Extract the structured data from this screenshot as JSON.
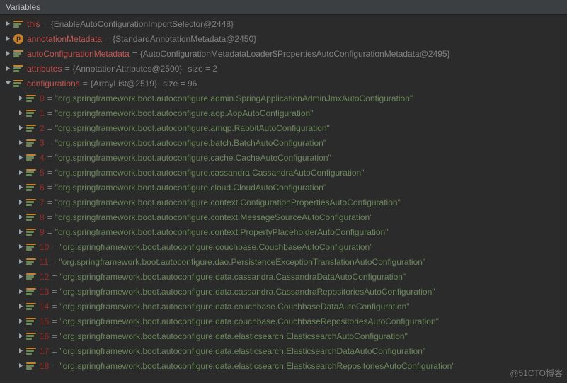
{
  "panelTitle": "Variables",
  "root": [
    {
      "name": "this",
      "value": "{EnableAutoConfigurationImportSelector@2448}",
      "nameColor": "name",
      "iconType": "obj"
    },
    {
      "name": "annotationMetadata",
      "value": "{StandardAnnotationMetadata@2450}",
      "nameColor": "name",
      "iconType": "p"
    },
    {
      "name": "autoConfigurationMetadata",
      "value": "{AutoConfigurationMetadataLoader$PropertiesAutoConfigurationMetadata@2495}",
      "nameColor": "name",
      "iconType": "obj"
    },
    {
      "name": "attributes",
      "value": "{AnnotationAttributes@2500}",
      "size": "size = 2",
      "nameColor": "name",
      "iconType": "obj"
    }
  ],
  "configurations": {
    "name": "configurations",
    "value": "{ArrayList@2519}",
    "size": "size = 96",
    "items": [
      {
        "idx": "0",
        "str": "\"org.springframework.boot.autoconfigure.admin.SpringApplicationAdminJmxAutoConfiguration\""
      },
      {
        "idx": "1",
        "str": "\"org.springframework.boot.autoconfigure.aop.AopAutoConfiguration\""
      },
      {
        "idx": "2",
        "str": "\"org.springframework.boot.autoconfigure.amqp.RabbitAutoConfiguration\""
      },
      {
        "idx": "3",
        "str": "\"org.springframework.boot.autoconfigure.batch.BatchAutoConfiguration\""
      },
      {
        "idx": "4",
        "str": "\"org.springframework.boot.autoconfigure.cache.CacheAutoConfiguration\""
      },
      {
        "idx": "5",
        "str": "\"org.springframework.boot.autoconfigure.cassandra.CassandraAutoConfiguration\""
      },
      {
        "idx": "6",
        "str": "\"org.springframework.boot.autoconfigure.cloud.CloudAutoConfiguration\""
      },
      {
        "idx": "7",
        "str": "\"org.springframework.boot.autoconfigure.context.ConfigurationPropertiesAutoConfiguration\""
      },
      {
        "idx": "8",
        "str": "\"org.springframework.boot.autoconfigure.context.MessageSourceAutoConfiguration\""
      },
      {
        "idx": "9",
        "str": "\"org.springframework.boot.autoconfigure.context.PropertyPlaceholderAutoConfiguration\""
      },
      {
        "idx": "10",
        "str": "\"org.springframework.boot.autoconfigure.couchbase.CouchbaseAutoConfiguration\""
      },
      {
        "idx": "11",
        "str": "\"org.springframework.boot.autoconfigure.dao.PersistenceExceptionTranslationAutoConfiguration\""
      },
      {
        "idx": "12",
        "str": "\"org.springframework.boot.autoconfigure.data.cassandra.CassandraDataAutoConfiguration\""
      },
      {
        "idx": "13",
        "str": "\"org.springframework.boot.autoconfigure.data.cassandra.CassandraRepositoriesAutoConfiguration\""
      },
      {
        "idx": "14",
        "str": "\"org.springframework.boot.autoconfigure.data.couchbase.CouchbaseDataAutoConfiguration\""
      },
      {
        "idx": "15",
        "str": "\"org.springframework.boot.autoconfigure.data.couchbase.CouchbaseRepositoriesAutoConfiguration\""
      },
      {
        "idx": "16",
        "str": "\"org.springframework.boot.autoconfigure.data.elasticsearch.ElasticsearchAutoConfiguration\""
      },
      {
        "idx": "17",
        "str": "\"org.springframework.boot.autoconfigure.data.elasticsearch.ElasticsearchDataAutoConfiguration\""
      },
      {
        "idx": "18",
        "str": "\"org.springframework.boot.autoconfigure.data.elasticsearch.ElasticsearchRepositoriesAutoConfiguration\""
      }
    ]
  },
  "watermark": "@51CTO博客"
}
